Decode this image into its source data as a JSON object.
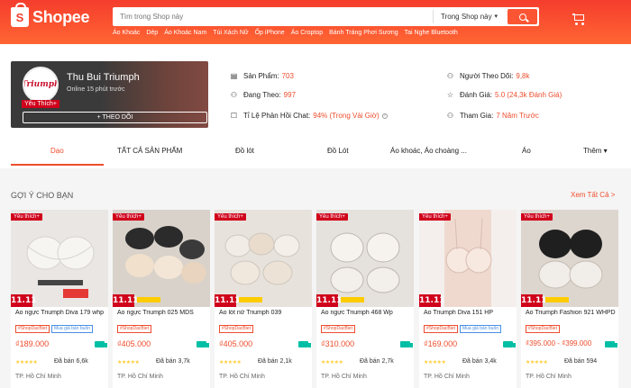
{
  "header": {
    "logo": "Shopee",
    "search_placeholder": "Tìm trong Shop này",
    "search_scope": "Trong Shop này",
    "quick_links": [
      "Áo Khoác",
      "Dép",
      "Áo Khoác Nam",
      "Túi Xách Nữ",
      "Ốp iPhone",
      "Áo Croptop",
      "Bánh Tráng Phơi Sương",
      "Tai Nghe Bluetooth"
    ]
  },
  "shop": {
    "name": "Thu Bui Triumph",
    "online": "Online 15 phút trước",
    "badge": "Yêu Thích+",
    "avatar_text": "Triumph",
    "follow_label": "THEO DÕI",
    "stats": {
      "products_label": "Sản Phẩm:",
      "products_value": "703",
      "following_label": "Đang Theo:",
      "following_value": "997",
      "response_label": "Tỉ Lệ Phản Hồi Chat:",
      "response_value": "94% (Trong Vài Giờ)",
      "followers_label": "Người Theo Dõi:",
      "followers_value": "9,8k",
      "rating_label": "Đánh Giá:",
      "rating_value": "5.0 (24,3k Đánh Giá)",
      "joined_label": "Tham Gia:",
      "joined_value": "7 Năm Trước"
    }
  },
  "tabs": [
    "Dạo",
    "TẤT CẢ SẢN PHẨM",
    "Đồ lót",
    "Đồ Lót",
    "Áo khoác, Áo choàng ...",
    "Áo",
    "Thêm ▾"
  ],
  "recommend": {
    "title": "GỢI Ý CHO BẠN",
    "see_all": "Xem Tất Cả >"
  },
  "products": [
    {
      "name": "Áo ngực Triumph Diva 179 whp",
      "price": "₫189.000",
      "sold": "Đã bán 6,6k",
      "location": "TP. Hồ Chí Minh",
      "tag1": "#ShopDacBiet",
      "tag2": "Mua giá bán buôn",
      "fav": "Yêu thích+",
      "promo": "11.11"
    },
    {
      "name": "Áo ngực Triumph 025 MDS",
      "price": "₫405.000",
      "sold": "Đã bán 3,7k",
      "location": "TP. Hồ Chí Minh",
      "tag1": "#ShopDacBiet",
      "tag2": "",
      "fav": "Yêu thích+",
      "promo": "11.11"
    },
    {
      "name": "Áo lót nữ Triumph 039",
      "price": "₫405.000",
      "sold": "Đã bán 2,1k",
      "location": "TP. Hồ Chí Minh",
      "tag1": "#ShopDacBiet",
      "tag2": "",
      "fav": "Yêu thích+",
      "promo": "11.11"
    },
    {
      "name": "Áo ngực Triumph 468 Wp",
      "price": "₫310.000",
      "sold": "Đã bán 2,7k",
      "location": "TP. Hồ Chí Minh",
      "tag1": "#ShopDacBiet",
      "tag2": "",
      "fav": "Yêu thích+",
      "promo": "11.11"
    },
    {
      "name": "Áo Triumph Diva 151 HP",
      "price": "₫169.000",
      "sold": "Đã bán 3,4k",
      "location": "TP. Hồ Chí Minh",
      "tag1": "#ShopDacBiet",
      "tag2": "Mua giá bán buôn",
      "fav": "Yêu thích+",
      "promo": "11.11"
    },
    {
      "name": "Áo Triumph Fashion 921 WHPD",
      "price": "₫395.000 - ₫399.000",
      "sold": "Đã bán 594",
      "location": "TP. Hồ Chí Minh",
      "tag1": "#ShopDacBiet",
      "tag2": "",
      "fav": "Yêu thích+",
      "promo": "11.11"
    }
  ],
  "colors": {
    "brand": "#ee4d2d",
    "header": "#f53d2d",
    "favorite": "#d0011b"
  }
}
